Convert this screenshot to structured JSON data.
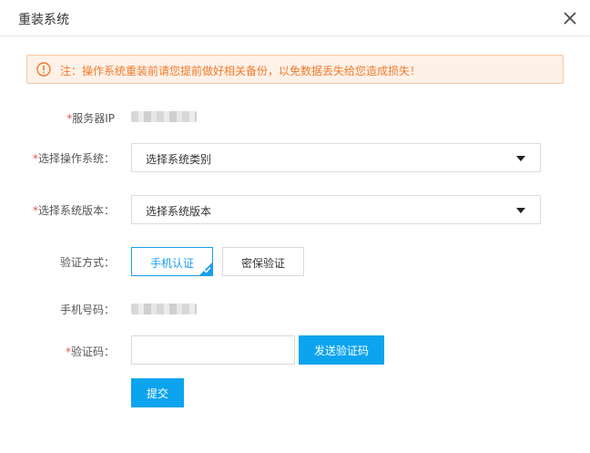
{
  "dialog": {
    "title": "重装系统",
    "close_icon": "close-icon"
  },
  "notice": {
    "icon": "warning-circle-icon",
    "text": "注：操作系统重装前请您提前做好相关备份，以免数据丢失给您造成损失！"
  },
  "form": {
    "required_mark": "*",
    "server_ip_label": "服务器IP",
    "os_label": "选择操作系统：",
    "os_value": "选择系统类别",
    "version_label": "选择系统版本：",
    "version_value": "选择系统版本",
    "verify_method_label": "验证方式：",
    "verify_options": [
      {
        "label": "手机认证",
        "selected": true
      },
      {
        "label": "密保验证",
        "selected": false
      }
    ],
    "phone_label": "手机号码：",
    "code_label": "验证码：",
    "code_value": "",
    "send_code_label": "发送验证码",
    "submit_label": "提交"
  },
  "colors": {
    "accent": "#0ca4ef",
    "warning_text": "#f07b2a",
    "warning_bg": "#fdf1e8",
    "required": "#e5534b"
  }
}
